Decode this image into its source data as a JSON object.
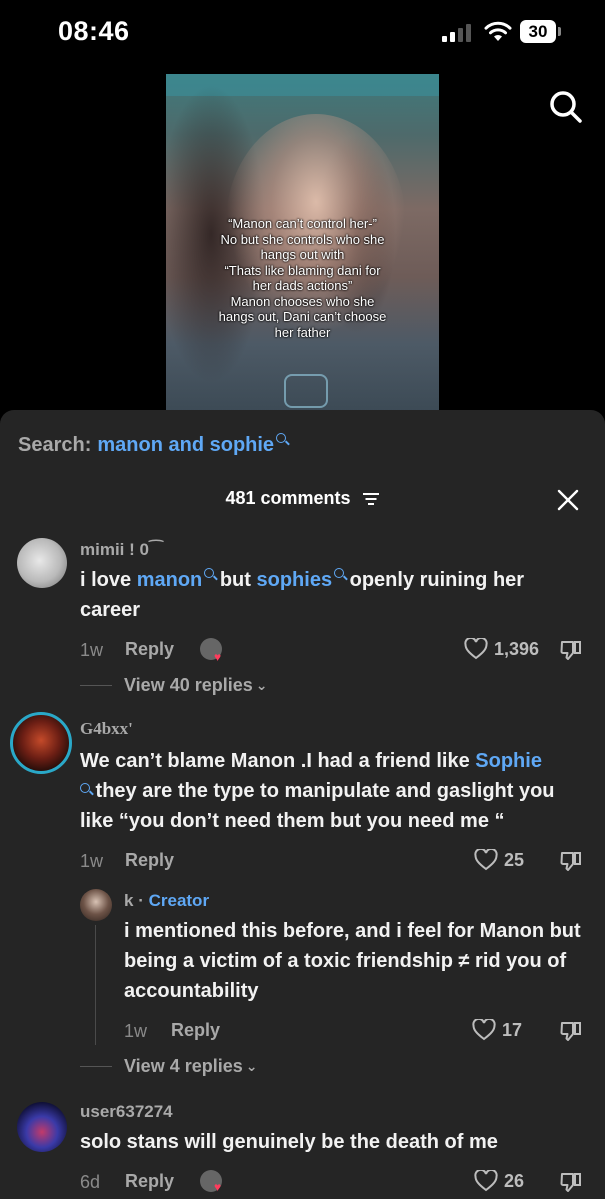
{
  "status": {
    "time": "08:46",
    "battery": "30"
  },
  "video": {
    "caption": "“Manon can’t control her-”\nNo but she controls who she\nhangs out with\n“Thats like blaming dani for\nher dads actions”\nManon chooses who she\nhangs out, Dani can’t choose\nher father"
  },
  "search": {
    "label": "Search:",
    "query": "manon and sophie"
  },
  "comments_header": {
    "count": "481 comments"
  },
  "comments": [
    {
      "username": "mimii ! 0⁀",
      "text_pre": "i love ",
      "link1": "manon",
      "text_mid": " but ",
      "link2": "sophies",
      "text_post": " openly ruining her career",
      "time": "1w",
      "reply": "Reply",
      "likes": "1,396",
      "view_replies": "View 40 replies"
    },
    {
      "username": "G4bxx'",
      "text_pre": "We can’t blame Manon .I had a friend like ",
      "link1": "Sophie",
      "text_post": " they are the type to manipulate and gaslight you like “you don’t need them but you need me “",
      "time": "1w",
      "reply": "Reply",
      "likes": "25"
    },
    {
      "username": "k",
      "badge": "Creator",
      "text": "i mentioned this before, and i feel for Manon but being a victim of a toxic friendship ≠ rid you of accountability",
      "time": "1w",
      "reply": "Reply",
      "likes": "17",
      "view_replies": "View 4 replies"
    },
    {
      "username": "user637274",
      "text": "solo stans will genuinely be the death of me",
      "time": "6d",
      "reply": "Reply",
      "likes": "26"
    }
  ],
  "colors": {
    "accent": "#5fa8f5",
    "panel": "#252525",
    "liked_heart": "#ff3b5c"
  }
}
